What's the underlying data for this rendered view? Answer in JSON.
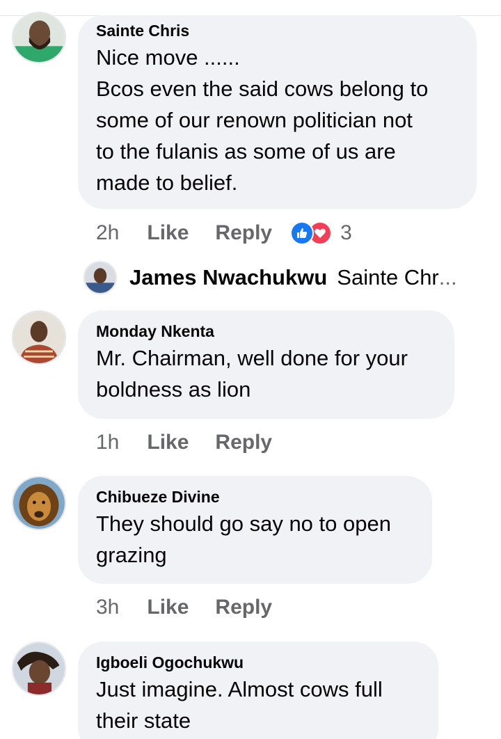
{
  "comments": [
    {
      "author": "Sainte Chris",
      "lines": [
        "Nice move ......",
        "Bcos even the said cows belong to",
        "some of our renown politician not",
        "to the fulanis as some of us are",
        "made to belief."
      ],
      "time": "2h",
      "like_label": "Like",
      "reply_label": "Reply",
      "reactions": {
        "count": "3",
        "icons": [
          "like-icon",
          "love-icon"
        ]
      },
      "reply_preview": {
        "author": "James Nwachukwu",
        "text": "Sainte Chr",
        "ellipsis": "..."
      }
    },
    {
      "author": "Monday Nkenta",
      "lines": [
        "Mr. Chairman, well done for your",
        "boldness as lion"
      ],
      "time": "1h",
      "like_label": "Like",
      "reply_label": "Reply"
    },
    {
      "author": "Chibueze Divine",
      "lines": [
        "They should go say no to open",
        "grazing"
      ],
      "time": "3h",
      "like_label": "Like",
      "reply_label": "Reply"
    },
    {
      "author": "Igboeli Ogochukwu",
      "lines": [
        "Just imagine. Almost cows full",
        "their state"
      ]
    }
  ],
  "colors": {
    "bubble": "#f0f2f5",
    "text": "#050505",
    "meta": "#65676b",
    "like_blue": "#1877f2",
    "love_red": "#f33e58"
  }
}
